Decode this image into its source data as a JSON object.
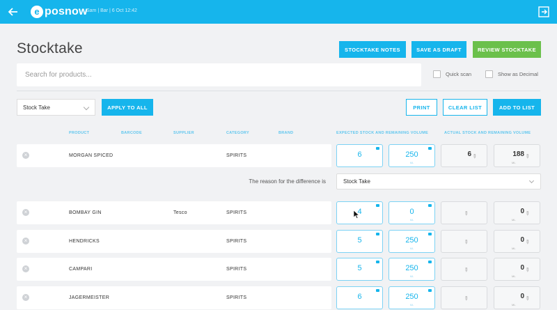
{
  "topbar": {
    "logo_mark": "e",
    "logo_text": "posnow",
    "info": "Sam | Bar | 6 Oct 12:42",
    "back_icon": "arrow-left-icon",
    "exit_icon": "sign-out-icon"
  },
  "page_title": "Stocktake",
  "toolbar": {
    "notes_label": "STOCKTAKE NOTES",
    "draft_label": "SAVE AS DRAFT",
    "review_label": "REVIEW STOCKTAKE"
  },
  "search": {
    "placeholder": "Search for products..."
  },
  "options": {
    "quick_scan": "Quick scan",
    "show_decimal": "Show as Decimal"
  },
  "actions": {
    "select_value": "Stock Take",
    "apply_label": "APPLY TO ALL",
    "print_label": "PRINT",
    "clear_label": "CLEAR LIST",
    "add_label": "ADD TO LIST"
  },
  "columns": {
    "product": "PRODUCT",
    "barcode": "BARCODE",
    "supplier": "SUPPLIER",
    "category": "CATEGORY",
    "brand": "BRAND",
    "expected": "EXPECTED STOCK AND REMAINING VOLUME",
    "actual": "ACTUAL STOCK AND REMAINING VOLUME"
  },
  "reason": {
    "label": "The reason for the difference is",
    "value": "Stock Take"
  },
  "rows": [
    {
      "product": "MORGAN SPICED",
      "supplier": "",
      "category": "SPIRITS",
      "expected_stock": "6",
      "expected_volume": "250",
      "expected_unit": "ML",
      "actual_stock": "6",
      "actual_volume": "188",
      "actual_unit": "ML"
    },
    {
      "product": "BOMBAY GIN",
      "supplier": "Tesco",
      "category": "SPIRITS",
      "expected_stock": "4",
      "expected_volume": "0",
      "expected_unit": "ML",
      "actual_stock": "",
      "actual_volume": "0",
      "actual_unit": "ML"
    },
    {
      "product": "HENDRICKS",
      "supplier": "",
      "category": "SPIRITS",
      "expected_stock": "5",
      "expected_volume": "250",
      "expected_unit": "ML",
      "actual_stock": "",
      "actual_volume": "0",
      "actual_unit": "ML"
    },
    {
      "product": "CAMPARI",
      "supplier": "",
      "category": "SPIRITS",
      "expected_stock": "5",
      "expected_volume": "250",
      "expected_unit": "ML",
      "actual_stock": "",
      "actual_volume": "0",
      "actual_unit": "ML"
    },
    {
      "product": "JAGERMEISTER",
      "supplier": "",
      "category": "SPIRITS",
      "expected_stock": "6",
      "expected_volume": "250",
      "expected_unit": "ML",
      "actual_stock": "",
      "actual_volume": "0",
      "actual_unit": "ML"
    }
  ],
  "colors": {
    "brand": "#16b5ec",
    "review": "#6bc04b",
    "background": "#f1f2f4"
  }
}
